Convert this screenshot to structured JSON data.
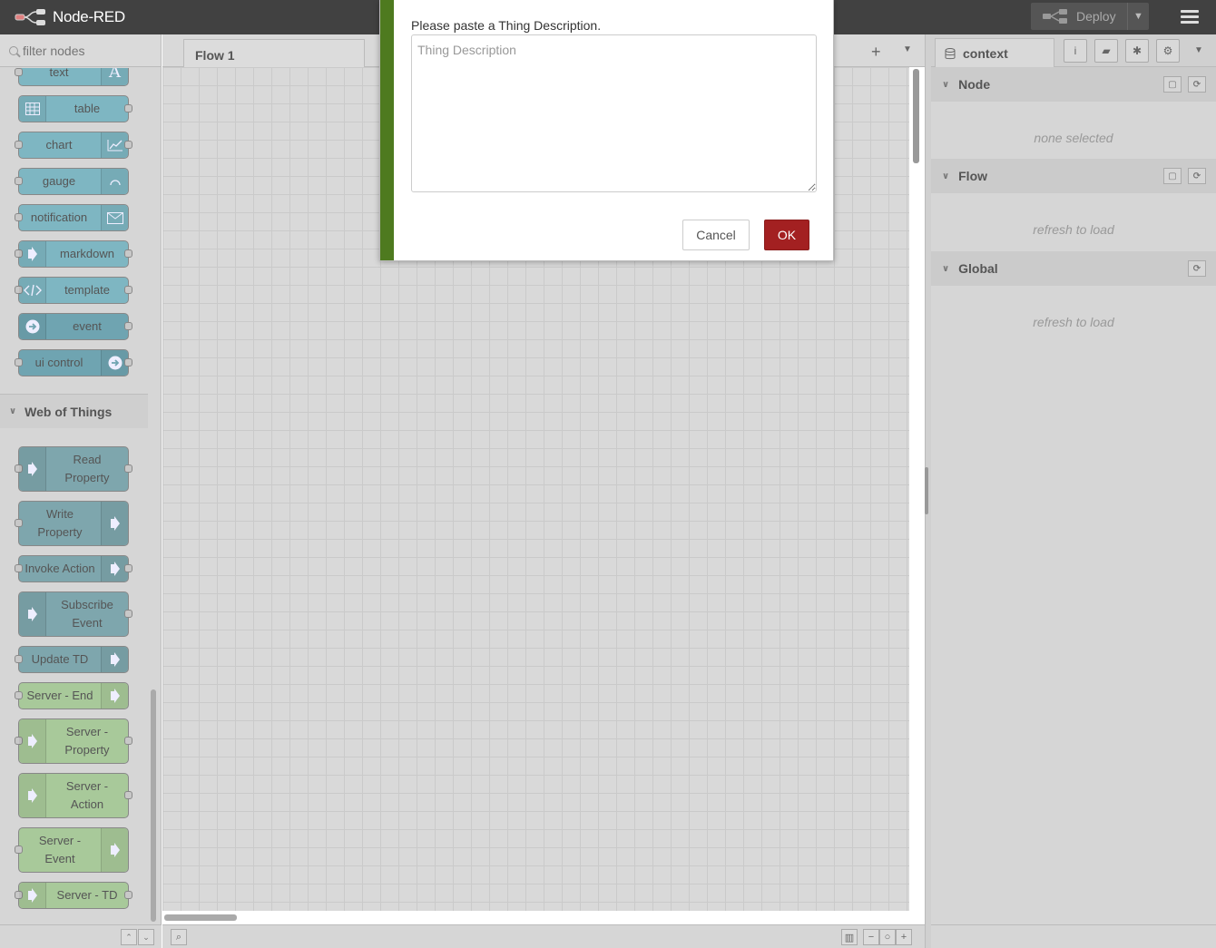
{
  "header": {
    "app_title": "Node-RED",
    "deploy_label": "Deploy"
  },
  "palette": {
    "filter_placeholder": "filter nodes",
    "dashboard_nodes": [
      "text",
      "table",
      "chart",
      "gauge",
      "notification",
      "markdown",
      "template",
      "event",
      "ui control"
    ],
    "category": "Web of Things",
    "wot_nodes": [
      "Read Property",
      "Write Property",
      "Invoke Action",
      "Subscribe Event",
      "Update TD"
    ],
    "server_nodes": [
      "Server - End",
      "Server - Property",
      "Server - Action",
      "Server - Event",
      "Server - TD"
    ]
  },
  "workspace": {
    "tab_label": "Flow 1"
  },
  "sidebar": {
    "tab_label": "context",
    "sections": [
      {
        "title": "Node",
        "body": "none selected"
      },
      {
        "title": "Flow",
        "body": "refresh to load"
      },
      {
        "title": "Global",
        "body": "refresh to load"
      }
    ]
  },
  "dialog": {
    "message": "Please paste a Thing Description.",
    "placeholder": "Thing Description",
    "cancel_label": "Cancel",
    "ok_label": "OK"
  },
  "colors": {
    "dialog_strip": "#4e7a1f",
    "ok_button": "#a32021",
    "dashboard_node": "#7eb6c2",
    "wot_node": "#7ea6ad",
    "server_node": "#a8c99a"
  }
}
